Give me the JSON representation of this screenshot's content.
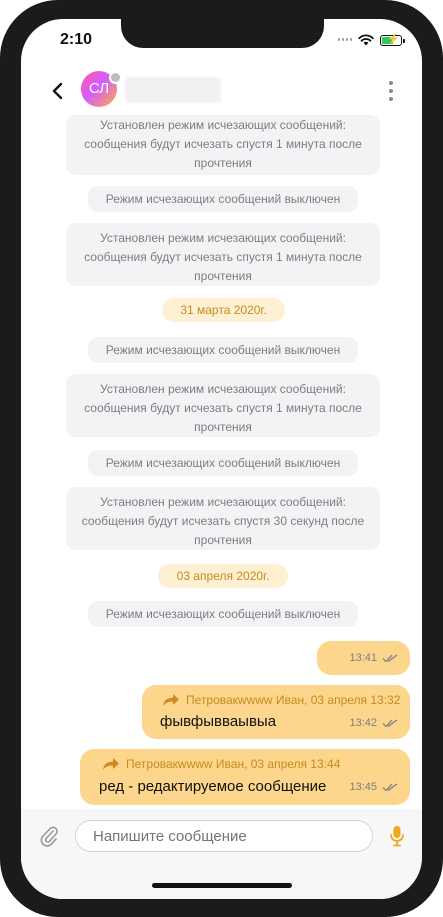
{
  "status_bar": {
    "time": "2:10"
  },
  "header": {
    "avatar_initials": "СЛ",
    "contact_name": ""
  },
  "messages": [
    {
      "type": "system",
      "text": "Установлен режим исчезающих сообщений: сообщения будут исчезать спустя 1 минута после прочтения"
    },
    {
      "type": "system",
      "text": "Режим исчезающих сообщений выключен"
    },
    {
      "type": "system",
      "text": "Установлен режим исчезающих сообщений: сообщения будут исчезать спустя 1 минута после прочтения"
    },
    {
      "type": "date",
      "text": "31 марта 2020г."
    },
    {
      "type": "system",
      "text": "Режим исчезающих сообщений выключен"
    },
    {
      "type": "system",
      "text": "Установлен режим исчезающих сообщений: сообщения будут исчезать спустя 1 минута после прочтения"
    },
    {
      "type": "system",
      "text": "Режим исчезающих сообщений выключен"
    },
    {
      "type": "system",
      "text": "Установлен режим исчезающих сообщений: сообщения будут исчезать спустя 30 секунд после прочтения"
    },
    {
      "type": "date",
      "text": "03 апреля 2020г."
    },
    {
      "type": "system",
      "text": "Режим исчезающих сообщений выключен"
    },
    {
      "type": "outgoing",
      "text": "",
      "time": "13:41",
      "read": true
    },
    {
      "type": "outgoing",
      "forwarded_from": "Петровакwwww Иван, 03 апреля 13:32",
      "text": "фывфывваывыа",
      "time": "13:42",
      "read": true
    },
    {
      "type": "outgoing",
      "forwarded_from": "Петровакwwww Иван, 03 апреля 13:44",
      "text": "ред - редактируемое сообщение",
      "time": "13:45",
      "read": true
    }
  ],
  "input": {
    "placeholder": "Напишите сообщение"
  },
  "colors": {
    "outgoing_bubble": "#fcd68d",
    "date_chip": "#fdf0d3",
    "accent": "#f0a81e",
    "system_bubble": "#f3f3f5"
  },
  "icons": {
    "back": "chevron-left-icon",
    "menu": "more-vertical-icon",
    "attach": "paperclip-icon",
    "mic": "microphone-icon",
    "forward": "forward-arrow-icon",
    "read": "double-check-icon"
  }
}
